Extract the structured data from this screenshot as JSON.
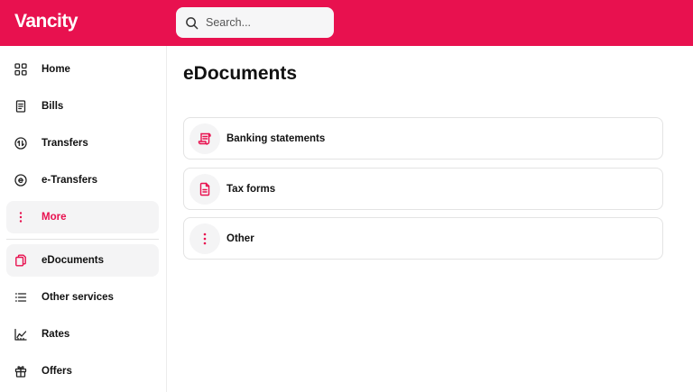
{
  "brand": {
    "logo_text": "Vancity",
    "accent_color": "#e8114f"
  },
  "search": {
    "placeholder": "Search...",
    "value": ""
  },
  "sidebar": {
    "items": [
      {
        "label": "Home",
        "icon": "grid-icon"
      },
      {
        "label": "Bills",
        "icon": "receipt-icon"
      },
      {
        "label": "Transfers",
        "icon": "transfer-icon"
      },
      {
        "label": "e-Transfers",
        "icon": "e-transfer-icon"
      },
      {
        "label": "More",
        "icon": "more-vertical-icon"
      },
      {
        "label": "eDocuments",
        "icon": "documents-icon",
        "selected": true
      },
      {
        "label": "Other services",
        "icon": "list-icon"
      },
      {
        "label": "Rates",
        "icon": "chart-icon"
      },
      {
        "label": "Offers",
        "icon": "gift-icon"
      }
    ]
  },
  "main": {
    "title": "eDocuments",
    "cards": [
      {
        "label": "Banking statements",
        "icon": "statement-icon"
      },
      {
        "label": "Tax forms",
        "icon": "tax-form-icon"
      },
      {
        "label": "Other",
        "icon": "more-vertical-icon"
      }
    ]
  }
}
